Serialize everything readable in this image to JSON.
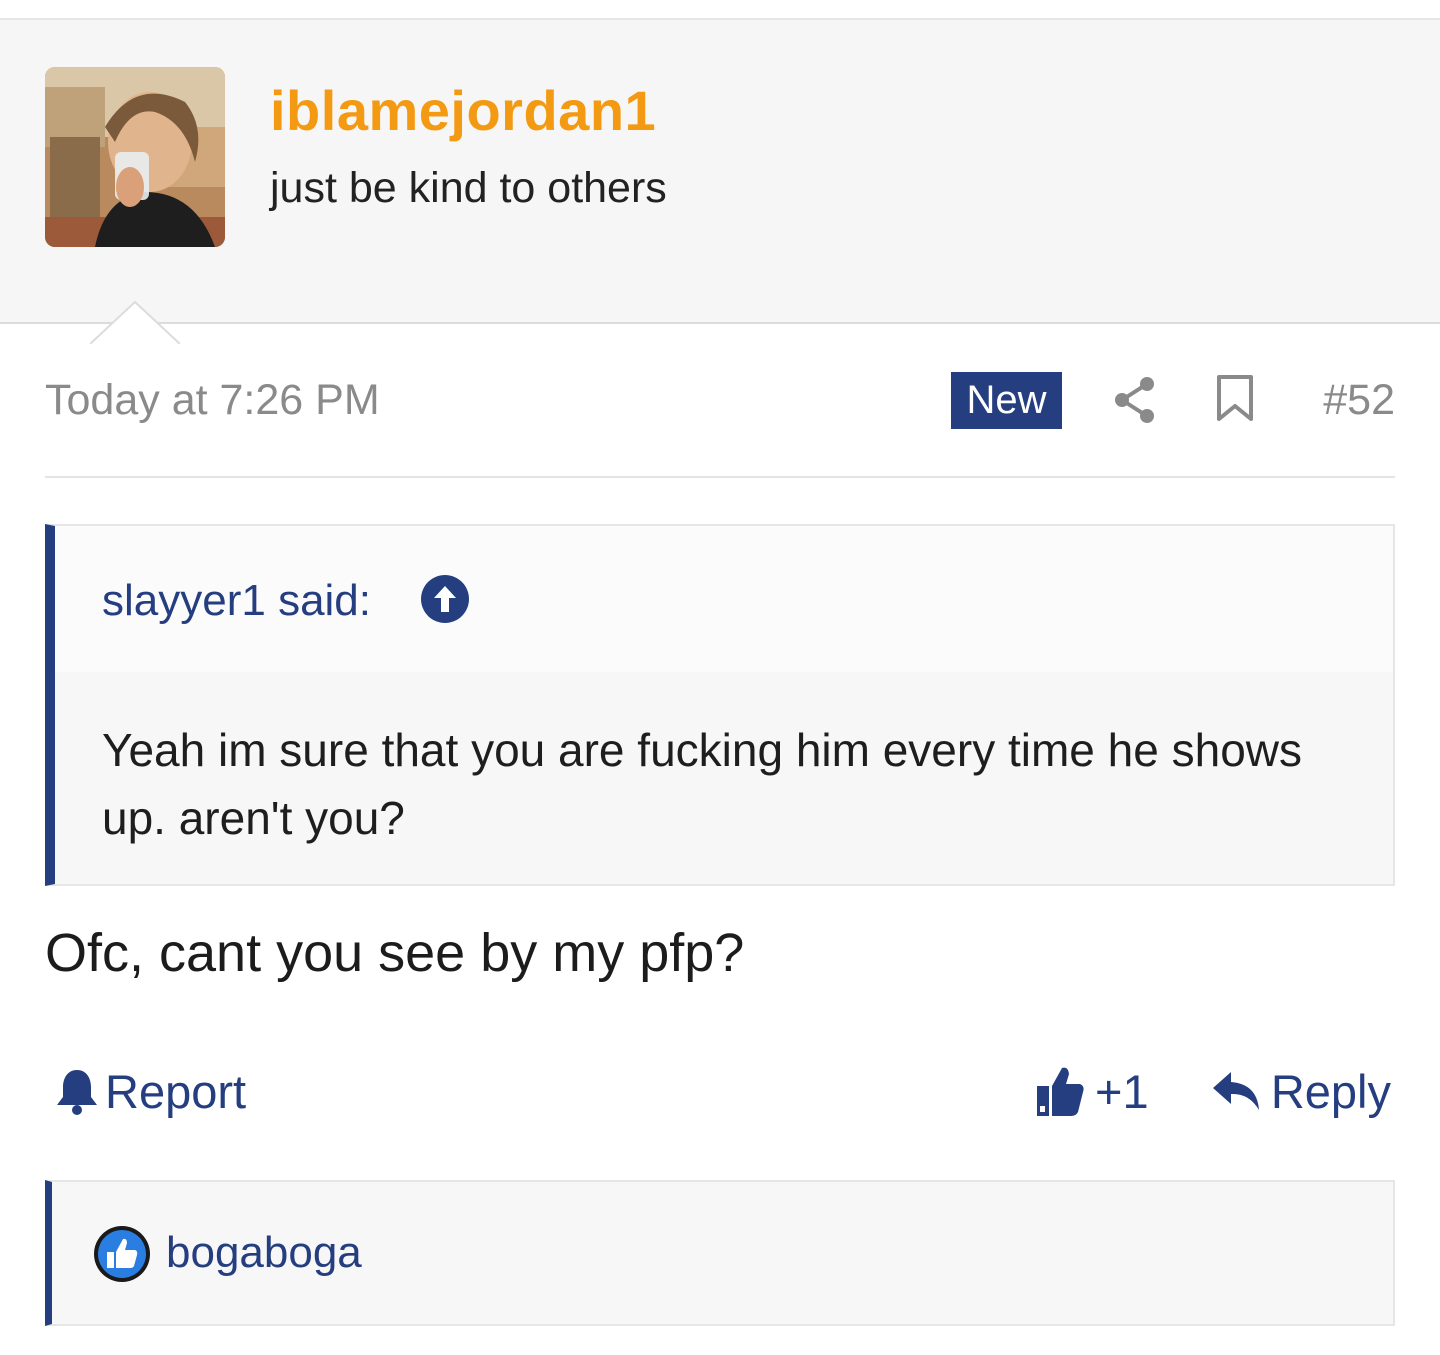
{
  "user": {
    "username": "iblamejordan1",
    "title": "just be kind to others"
  },
  "post": {
    "timestamp": "Today at 7:26 PM",
    "badge": "New",
    "number": "#52",
    "body": "Ofc, cant you see by my pfp?"
  },
  "quote": {
    "author": "slayyer1 said:",
    "text": "Yeah im sure that you are fucking him every time he shows up. aren't you?"
  },
  "actions": {
    "report_label": "Report",
    "like_count": "+1",
    "reply_label": "Reply"
  },
  "reactions": {
    "users": "bogaboga"
  },
  "colors": {
    "accent": "#253e80",
    "username": "#f39a12"
  }
}
